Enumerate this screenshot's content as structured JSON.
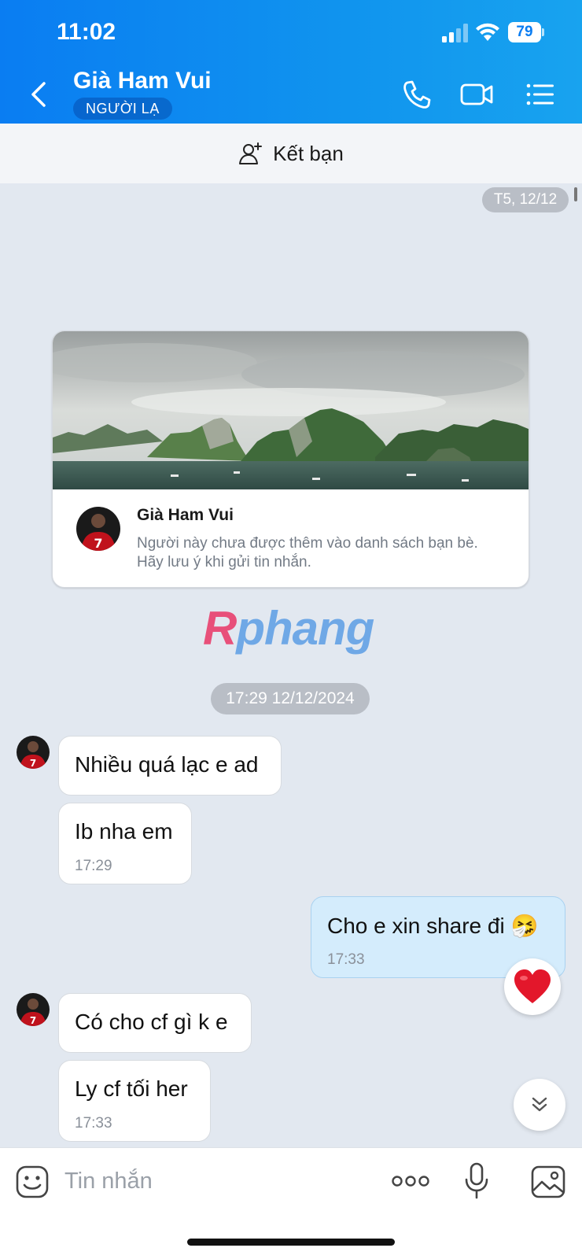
{
  "status_bar": {
    "time": "11:02",
    "battery": "79"
  },
  "header": {
    "contact_name": "Già Ham Vui",
    "badge": "NGƯỜI LẠ",
    "icons": [
      "back-icon",
      "phone-icon",
      "video-call-icon",
      "menu-list-icon"
    ]
  },
  "friend_bar": {
    "label": "Kết bạn",
    "icon": "add-user-icon"
  },
  "chat": {
    "date_pill": "T5, 12/12",
    "profile_card": {
      "name": "Già Ham Vui",
      "note": "Người này chưa được thêm vào danh sách bạn bè. Hãy lưu ý khi gửi tin nhắn."
    },
    "watermark": {
      "r": "R",
      "rest": "phang"
    },
    "datetime_pill": "17:29 12/12/2024",
    "messages": [
      {
        "sender": "other",
        "text": "Nhiều quá lạc e ad"
      },
      {
        "sender": "other",
        "text": "Ib nha em",
        "time": "17:29"
      },
      {
        "sender": "me",
        "text": "Cho e xin share đi 🤧",
        "time": "17:33",
        "reaction": "heart"
      },
      {
        "sender": "other",
        "text": "Có cho cf gì k e"
      },
      {
        "sender": "other",
        "text": "Ly cf tối her",
        "time": "17:33"
      }
    ]
  },
  "input": {
    "placeholder": "Tin nhắn",
    "icons": [
      "sticker-icon",
      "more-icon",
      "microphone-icon",
      "image-icon"
    ]
  },
  "colors": {
    "header": "#0a7df2",
    "chat_bg": "#e2e8f0",
    "my_bubble": "#d4ecfc"
  }
}
